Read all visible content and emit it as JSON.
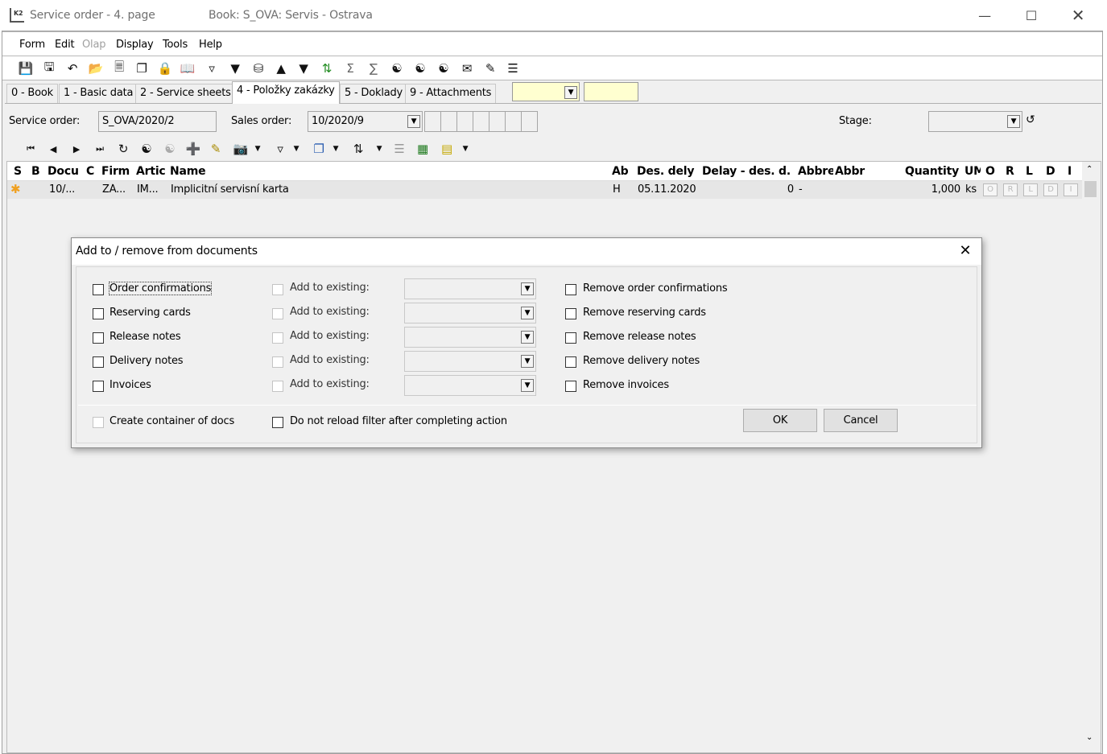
{
  "window": {
    "title": "Service order - 4. page",
    "book": "Book: S_OVA: Servis - Ostrava",
    "app_icon_text": "K2"
  },
  "menu": {
    "items": [
      "Form",
      "Edit",
      "Olap",
      "Display",
      "Tools",
      "Help"
    ]
  },
  "tabs": [
    {
      "label": "0 - Book"
    },
    {
      "label": "1 - Basic data"
    },
    {
      "label": "2 - Service sheets"
    },
    {
      "label": "4 - Položky zakázky"
    },
    {
      "label": "5 - Doklady"
    },
    {
      "label": "9 - Attachments"
    }
  ],
  "header_fields": {
    "service_order_label": "Service order:",
    "service_order_value": "S_OVA/2020/2",
    "sales_order_label": "Sales order:",
    "sales_order_value": "10/2020/9",
    "stage_label": "Stage:"
  },
  "grid": {
    "columns": [
      "S",
      "B",
      "Docu",
      "C",
      "Firm",
      "Artic",
      "Name",
      "Ab",
      "Des. dely",
      "Delay - des. d.",
      "Abbre",
      "Abbr",
      "Quantity",
      "UM",
      "O",
      "R",
      "L",
      "D",
      "I"
    ],
    "rows": [
      {
        "status": "✱",
        "docu": "10/...",
        "firm": "ZÁ...",
        "artic": "IM...",
        "name": "Implicitní servisní karta",
        "ab": "H",
        "des_dely": "05.11.2020",
        "delay": "0",
        "abbre": "-",
        "quantity": "1,000",
        "um": "ks",
        "flags": [
          "O",
          "R",
          "L",
          "D",
          "I"
        ]
      }
    ]
  },
  "dialog": {
    "title": "Add to / remove from documents",
    "rows": [
      {
        "doc": "Order confirmations",
        "add": "Add to existing:",
        "remove": "Remove order confirmations"
      },
      {
        "doc": "Reserving cards",
        "add": "Add to existing:",
        "remove": "Remove reserving cards"
      },
      {
        "doc": "Release notes",
        "add": "Add to existing:",
        "remove": "Remove release notes"
      },
      {
        "doc": "Delivery notes",
        "add": "Add to existing:",
        "remove": "Remove delivery notes"
      },
      {
        "doc": "Invoices",
        "add": "Add to existing:",
        "remove": "Remove invoices"
      }
    ],
    "create_container": "Create container of docs",
    "no_reload": "Do not reload filter after completing action",
    "ok": "OK",
    "cancel": "Cancel"
  }
}
